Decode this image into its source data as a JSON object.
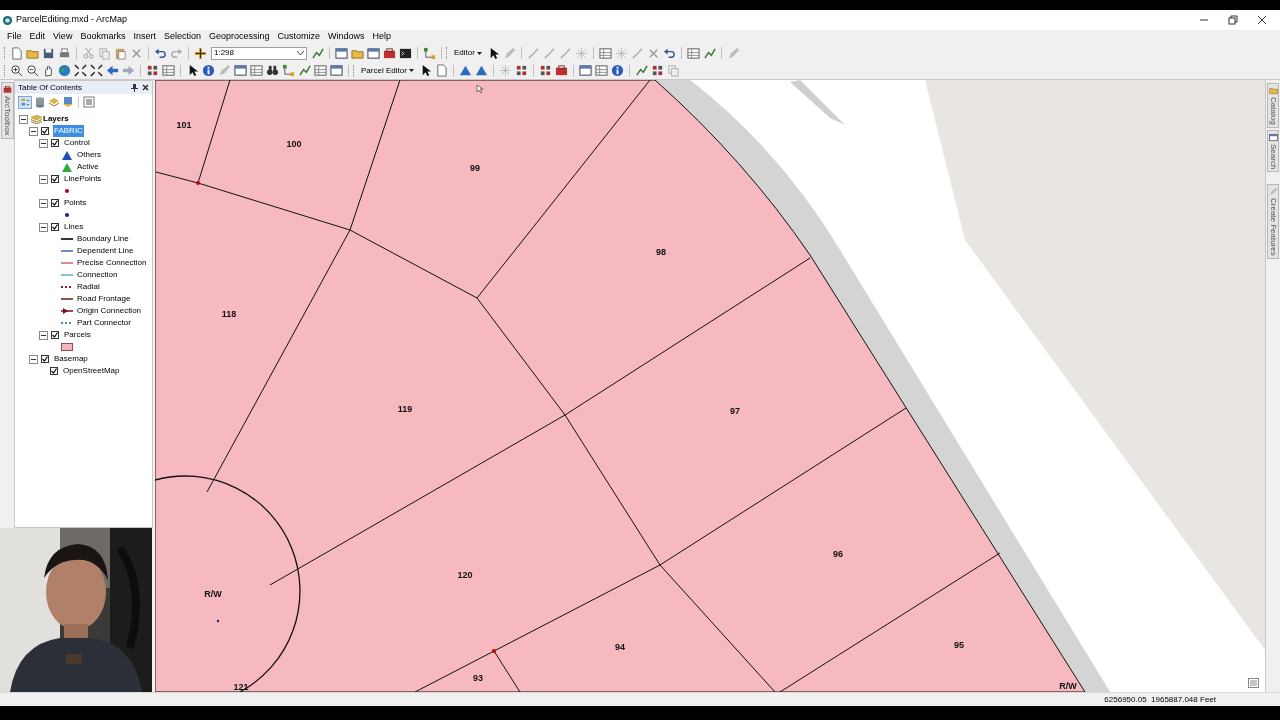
{
  "window": {
    "title": "ParcelEditing.mxd - ArcMap"
  },
  "menu": [
    "File",
    "Edit",
    "View",
    "Bookmarks",
    "Insert",
    "Selection",
    "Geoprocessing",
    "Customize",
    "Windows",
    "Help"
  ],
  "toolbar": {
    "scale": "1:298",
    "editor_menu": "Editor",
    "parcel_editor_menu": "Parcel Editor"
  },
  "left_tabs": [
    "ArcToolbox"
  ],
  "toc": {
    "title": "Table Of Contents",
    "tree": [
      {
        "label": "Layers",
        "kind": "group",
        "expanded": true,
        "selected": false,
        "children": [
          {
            "label": "FABRIC",
            "kind": "layer",
            "checked": true,
            "expanded": true,
            "selected": true,
            "children": [
              {
                "label": "Control",
                "kind": "layer",
                "checked": true,
                "expanded": true,
                "selected": false,
                "children": [
                  {
                    "label": "Others",
                    "kind": "legend-triangle",
                    "color": "#1f4fbf"
                  },
                  {
                    "label": "Active",
                    "kind": "legend-triangle",
                    "color": "#2fae3a"
                  }
                ]
              },
              {
                "label": "LinePoints",
                "kind": "layer",
                "checked": true,
                "expanded": true,
                "selected": false,
                "children": [
                  {
                    "kind": "legend-dot",
                    "color": "#b00020"
                  }
                ]
              },
              {
                "label": "Points",
                "kind": "layer",
                "checked": true,
                "expanded": true,
                "selected": false,
                "children": [
                  {
                    "kind": "legend-dot",
                    "color": "#1a237e"
                  }
                ]
              },
              {
                "label": "Lines",
                "kind": "layer",
                "checked": true,
                "expanded": true,
                "selected": false,
                "children": [
                  {
                    "label": "Boundary Line",
                    "kind": "legend-line",
                    "color": "#333333"
                  },
                  {
                    "label": "Dependent Line",
                    "kind": "legend-line",
                    "color": "#6a8ccf"
                  },
                  {
                    "label": "Precise Connection",
                    "kind": "legend-line",
                    "color": "#e08a8a"
                  },
                  {
                    "label": "Connection",
                    "kind": "legend-line",
                    "color": "#86c3e3"
                  },
                  {
                    "label": "Radial",
                    "kind": "legend-dashed",
                    "color": "#8b2020"
                  },
                  {
                    "label": "Road Frontage",
                    "kind": "legend-line",
                    "color": "#8b5a3c"
                  },
                  {
                    "label": "Origin Connection",
                    "kind": "legend-arrow",
                    "color": "#7a1010"
                  },
                  {
                    "label": "Part Connector",
                    "kind": "legend-dashed",
                    "color": "#4f7fbf"
                  }
                ]
              },
              {
                "label": "Parcels",
                "kind": "layer",
                "checked": true,
                "expanded": true,
                "selected": false,
                "children": [
                  {
                    "kind": "legend-fill",
                    "color": "#f4b6bd"
                  }
                ]
              }
            ]
          },
          {
            "label": "Basemap",
            "kind": "layer",
            "checked": true,
            "expanded": true,
            "selected": false,
            "children": [
              {
                "label": "OpenStreetMap",
                "kind": "layer",
                "checked": true,
                "selected": false
              }
            ]
          }
        ]
      }
    ]
  },
  "map": {
    "labels": [
      "101",
      "100",
      "99",
      "98",
      "118",
      "119",
      "97",
      "96",
      "120",
      "R/W",
      "94",
      "95",
      "93",
      "121",
      "R/W"
    ]
  },
  "right_tabs": [
    "Catalog",
    "Search",
    "Create Features"
  ],
  "status_bar": {
    "coordinates": "6256950.05  1965887.048 Feet"
  }
}
